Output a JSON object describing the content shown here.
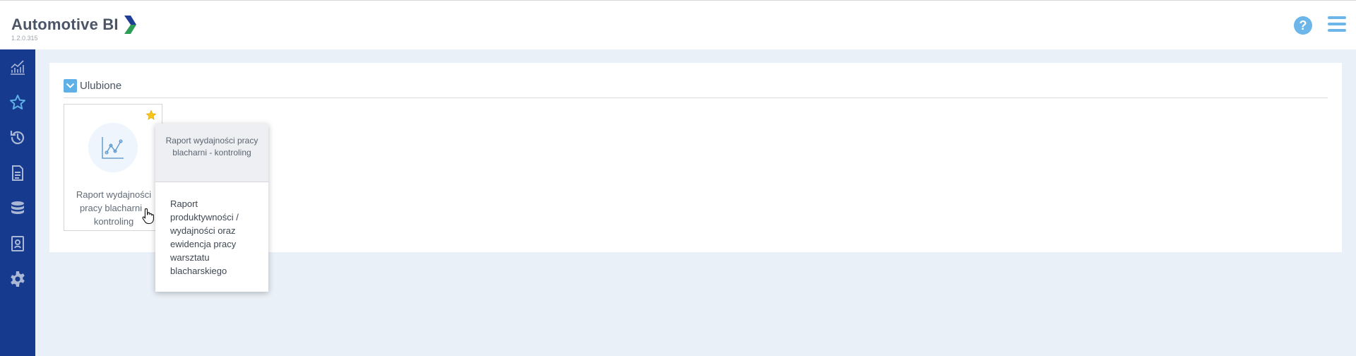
{
  "app": {
    "name": "Automotive BI",
    "version": "1.2.0.315"
  },
  "header": {
    "help_icon": "question-circle-icon",
    "help_glyph": "?",
    "menu_icon": "hamburger-menu-icon"
  },
  "sidebar": {
    "items": [
      {
        "icon": "chart-line-icon",
        "active": false
      },
      {
        "icon": "star-icon",
        "active": true
      },
      {
        "icon": "history-icon",
        "active": false
      },
      {
        "icon": "document-icon",
        "active": false
      },
      {
        "icon": "database-icon",
        "active": false
      },
      {
        "icon": "contact-card-icon",
        "active": false
      },
      {
        "icon": "gear-icon",
        "active": false
      }
    ]
  },
  "favorites": {
    "title": "Ulubione",
    "collapsed": false,
    "cards": [
      {
        "title": "Raport wydajności pracy blacharni - kontroling",
        "icon": "line-chart-icon",
        "favorite": true
      }
    ]
  },
  "tooltip": {
    "title": "Raport wydajności pracy blacharni - kontroling",
    "description": "Raport produktywności / wydajności oraz ewidencja pracy warsztatu blacharskiego"
  },
  "colors": {
    "sidebar_bg": "#163a8e",
    "accent": "#5fb0e6",
    "star_yellow": "#f5c518",
    "page_bg": "#e9f0f7"
  }
}
